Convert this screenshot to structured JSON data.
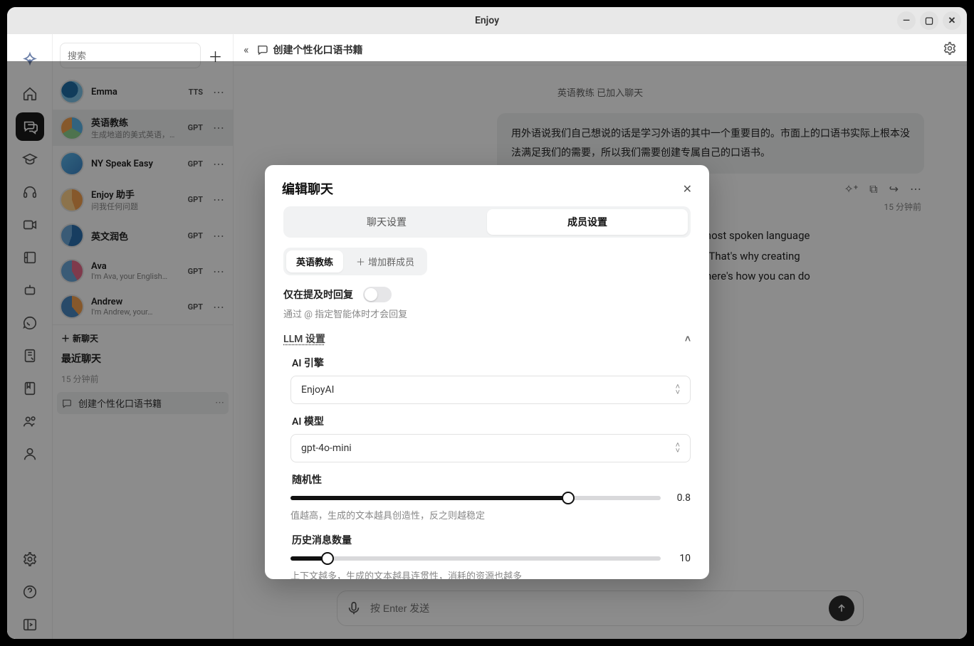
{
  "window": {
    "title": "Enjoy"
  },
  "sidebar": {
    "search_placeholder": "搜索",
    "agents": [
      {
        "name": "Emma",
        "desc": "",
        "badge": "TTS"
      },
      {
        "name": "英语教练",
        "desc": "生成地道的美式英语，超…",
        "badge": "GPT"
      },
      {
        "name": "NY Speak Easy",
        "desc": "",
        "badge": "GPT"
      },
      {
        "name": "Enjoy 助手",
        "desc": "问我任何问题",
        "badge": "GPT"
      },
      {
        "name": "英文润色",
        "desc": "",
        "badge": "GPT"
      },
      {
        "name": "Ava",
        "desc": "I'm Ava, your English…",
        "badge": "GPT"
      },
      {
        "name": "Andrew",
        "desc": "I'm Andrew, your…",
        "badge": "GPT"
      }
    ],
    "new_chat_label": "新聊天",
    "recent_title": "最近聊天",
    "recent_time": "15 分钟前",
    "recent_item": "创建个性化口语书籍"
  },
  "main": {
    "collapse_icon": "«",
    "title": "创建个性化口语书籍",
    "system_note": "英语教练 已加入聊天",
    "user_bubble": "用外语说我们自己想说的话是学习外语的其中一个重要目的。市面上的口语书实际上根本没法满足我们的需要，所以我们需要创建专属自己的口语书。",
    "bubble_time": "15 分钟前",
    "assistant_text": "One of the primary goals of learning a foreign language is to express ourselves. However, most spoken language books on the market fall short of our needs, offering phrases we don't actually want to say. That's why creating our own personalized spoken language book is essential. Enjoy makes this process easy—here's how you can do it.",
    "composer_placeholder": "按 Enter 发送"
  },
  "modal": {
    "title": "编辑聊天",
    "tabs": {
      "chat": "聊天设置",
      "member": "成员设置"
    },
    "member_pill": "英语教练",
    "add_member": "增加群成员",
    "reply_on_mention_label": "仅在提及时回复",
    "reply_on_mention_help": "通过 @ 指定智能体时才会回复",
    "llm_section": "LLM 设置",
    "engine_label": "AI 引擎",
    "engine_value": "EnjoyAI",
    "model_label": "AI 模型",
    "model_value": "gpt-4o-mini",
    "temp_label": "随机性",
    "temp_value": "0.8",
    "temp_pct": 75,
    "temp_help": "值越高，生成的文本越具创造性，反之则越稳定",
    "history_label": "历史消息数量",
    "history_value": "10",
    "history_pct": 10,
    "history_help": "上下文越多，生成的文本越具连贯性，消耗的资源也越多"
  }
}
